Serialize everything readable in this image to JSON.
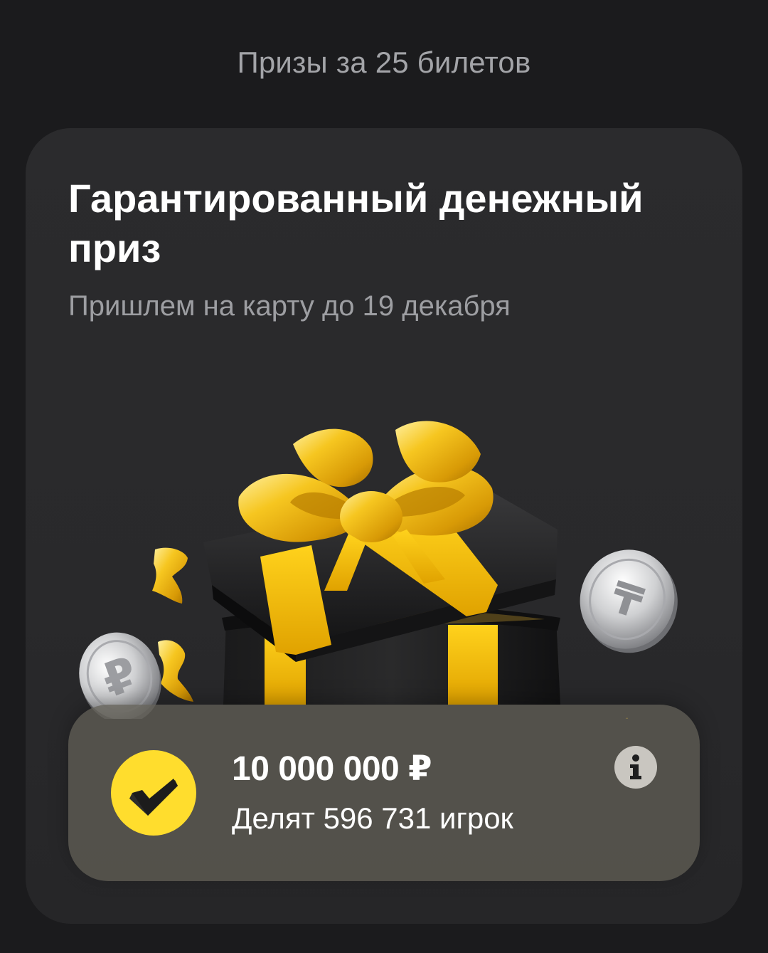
{
  "header": {
    "title": "Призы за 25 билетов"
  },
  "card": {
    "title": "Гарантированный денежный приз",
    "subtitle": "Пришлем на карту до 19 декабря",
    "illustration_icons": [
      "gift-box-icon",
      "ruble-coin-icon",
      "t-coin-icon",
      "confetti-icon"
    ],
    "prize": {
      "amount": "10 000 000 ₽",
      "players": "Делят 596 731 игрок",
      "badge_icon": "check-icon",
      "info_icon": "info-icon"
    }
  },
  "colors": {
    "background": "#1b1b1d",
    "card": "#2a2a2c",
    "accent_yellow": "#ffdd2d",
    "gold": "#f2bd12",
    "muted_text": "#a3a4a8"
  }
}
